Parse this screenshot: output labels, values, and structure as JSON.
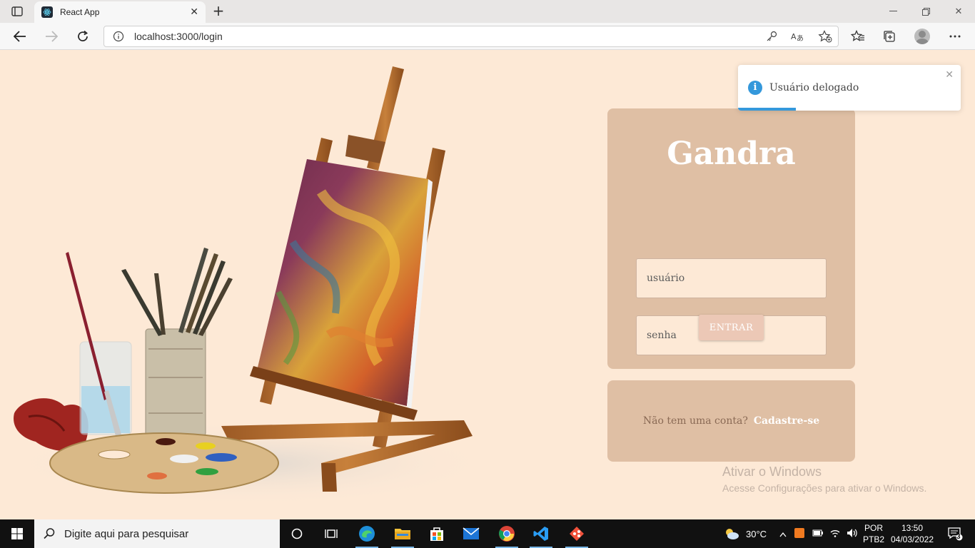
{
  "browser": {
    "tab_title": "React App",
    "url": "localhost:3000/login"
  },
  "login": {
    "brand": "Gandra",
    "username_placeholder": "usuário",
    "password_placeholder": "senha",
    "submit_label": "ENTRAR",
    "signup_prompt": "Não tem uma conta?",
    "signup_link": "Cadastre-se"
  },
  "toast": {
    "message": "Usuário delogado",
    "progress": 0.26,
    "accent": "#3498db"
  },
  "watermark": {
    "line1": "Ativar o Windows",
    "line2": "Acesse Configurações para ativar o Windows."
  },
  "taskbar": {
    "search_placeholder": "Digite aqui para pesquisar",
    "temperature": "30°C",
    "language_line1": "POR",
    "language_line2": "PTB2",
    "time": "13:50",
    "date": "04/03/2022",
    "notification_count": "3"
  },
  "colors": {
    "page_bg": "#fde9d6",
    "card_bg": "#dfbfa4",
    "button_bg": "#ecc8b6"
  }
}
